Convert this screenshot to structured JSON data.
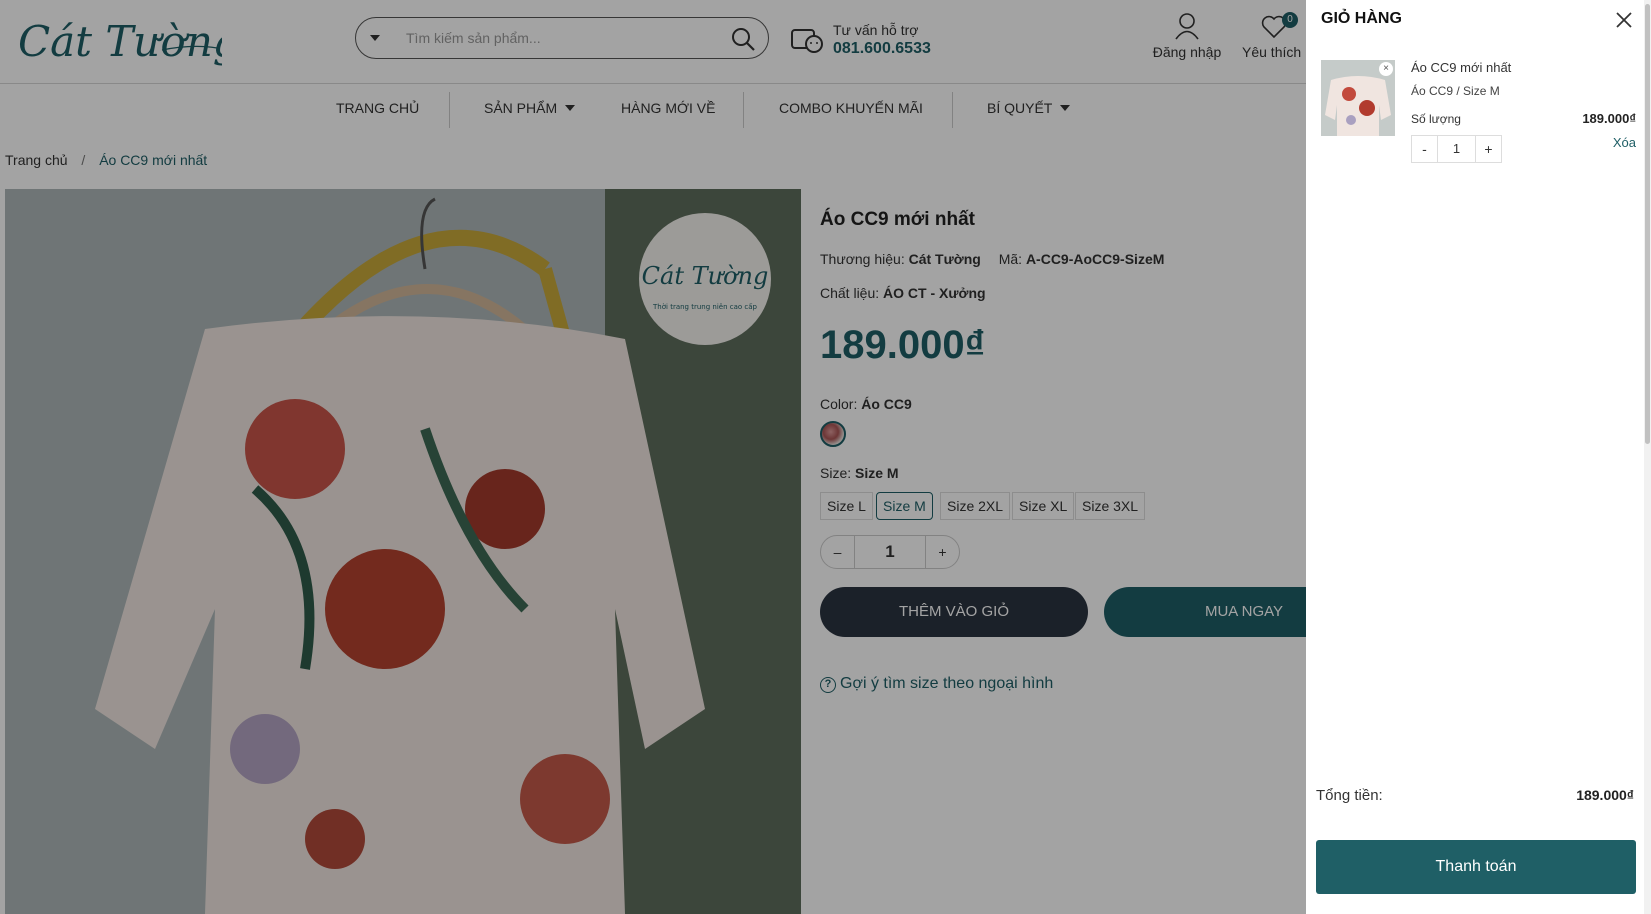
{
  "header": {
    "logo_text": "Cát Tường",
    "search_placeholder": "Tìm kiếm sản phẩm...",
    "support_label": "Tư vấn hỗ trợ",
    "support_phone": "081.600.6533",
    "login_label": "Đăng nhập",
    "favorites_label": "Yêu thích",
    "favorites_count": "0"
  },
  "nav": {
    "home": "TRANG CHỦ",
    "products": "SẢN PHẨM",
    "new_arrivals": "HÀNG MỚI VỀ",
    "combo": "COMBO KHUYẾN MÃI",
    "tips": "BÍ QUYẾT"
  },
  "breadcrumb": {
    "home": "Trang chủ",
    "separator": "/",
    "current": "Áo CC9 mới nhất"
  },
  "product": {
    "title": "Áo CC9 mới nhất",
    "brand_label": "Thương hiệu:",
    "brand": "Cát Tường",
    "sku_label": "Mã:",
    "sku": "A-CC9-AoCC9-SizeM",
    "material_label": "Chất liệu:",
    "material": "ÁO CT - Xưởng",
    "price": "189.000₫",
    "color_label": "Color:",
    "color_value": "Áo CC9",
    "size_label": "Size:",
    "size_value": "Size M",
    "sizes": [
      "Size L",
      "Size M",
      "Size 2XL",
      "Size XL",
      "Size 3XL"
    ],
    "quantity_minus": "–",
    "quantity": "1",
    "quantity_plus": "+",
    "add_to_cart": "THÊM VÀO GIỎ",
    "buy_now": "MUA NGAY",
    "size_hint": "Gợi ý tìm size theo ngoại hình",
    "image_logo_text": "Cát Tường",
    "image_logo_subtitle": "Thời trang trung niên cao cấp"
  },
  "cart": {
    "title": "GIỎ HÀNG",
    "item": {
      "name": "Áo CC9 mới nhất",
      "variant": "Áo CC9 / Size M",
      "qty_label": "Số lượng",
      "price": "189.000₫",
      "remove": "Xóa",
      "qty_minus": "-",
      "qty": "1",
      "qty_plus": "+"
    },
    "total_label": "Tổng tiền:",
    "total_value": "189.000₫",
    "checkout": "Thanh toán"
  },
  "colors": {
    "brand": "#1f5f66",
    "dark_button": "#2b3440"
  }
}
